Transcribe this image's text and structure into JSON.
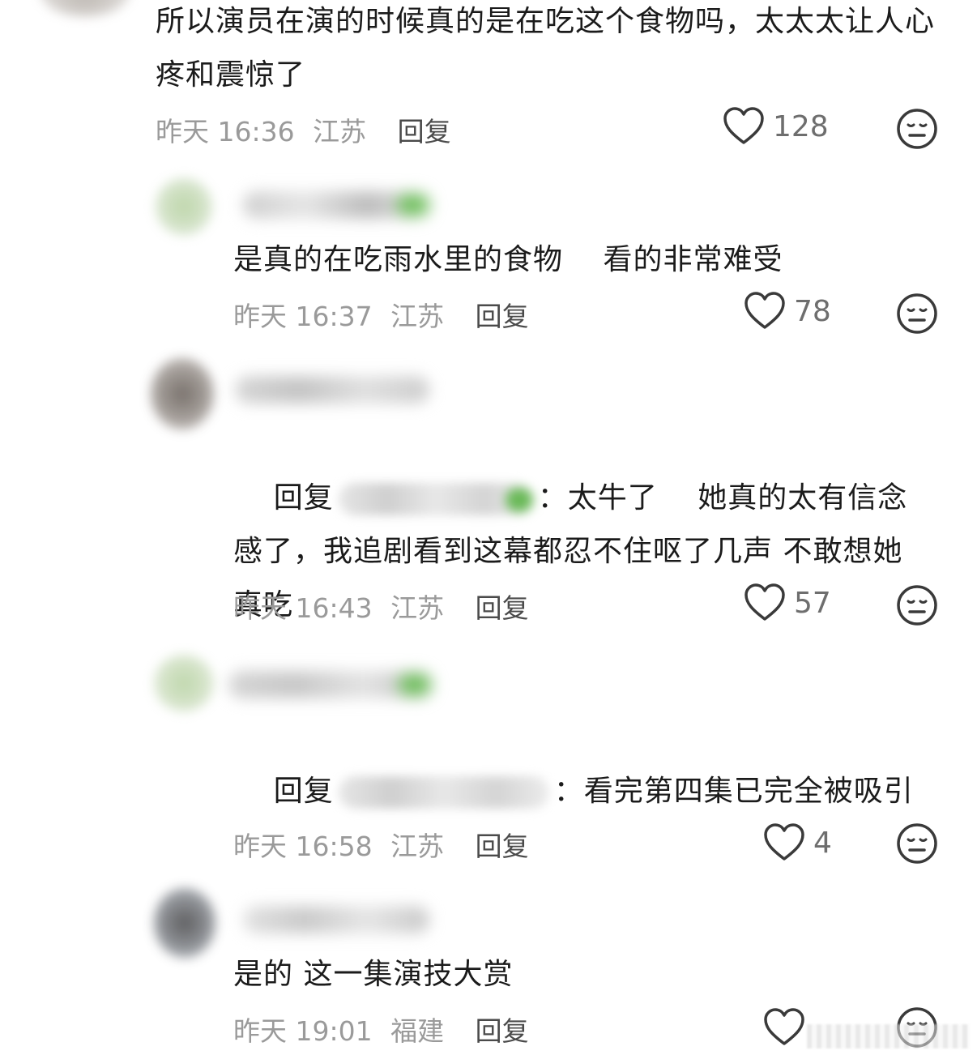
{
  "comments": [
    {
      "text": "所以演员在演的时候真的是在吃这个食物吗，太太太让人心疼和震惊了",
      "date": "昨天",
      "time": "16:36",
      "location": "江苏",
      "reply_label": "回复",
      "likes": "128"
    },
    {
      "text": "是真的在吃雨水里的食物　 看的非常难受",
      "date": "昨天",
      "time": "16:37",
      "location": "江苏",
      "reply_label": "回复",
      "likes": "78"
    },
    {
      "reply_prefix": "回复",
      "text": "：太牛了　 她真的太有信念感了，我追剧看到这幕都忍不住呕了几声 不敢想她真吃",
      "date": "昨天",
      "time": "16:43",
      "location": "江苏",
      "reply_label": "回复",
      "likes": "57"
    },
    {
      "reply_prefix": "回复",
      "text": "：看完第四集已完全被吸引",
      "date": "昨天",
      "time": "16:58",
      "location": "江苏",
      "reply_label": "回复",
      "likes": "4"
    },
    {
      "text": "是的 这一集演技大赏",
      "date": "昨天",
      "time": "19:01",
      "location": "福建",
      "reply_label": "回复",
      "likes": ""
    }
  ],
  "colors": {
    "text": "#1b1b1b",
    "meta": "#9a9a9a",
    "icon": "#3a3a3a"
  },
  "icons": [
    "heart-icon",
    "face-icon"
  ]
}
